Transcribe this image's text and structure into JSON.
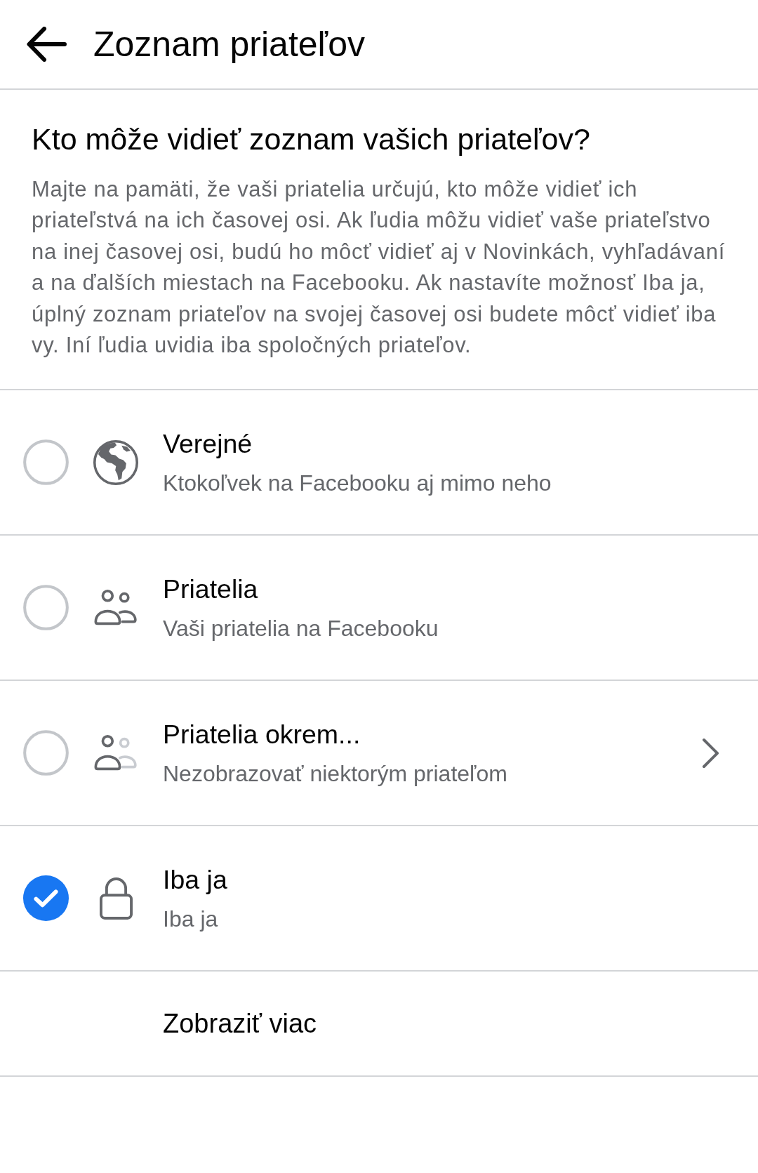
{
  "header": {
    "title": "Zoznam priateľov"
  },
  "section": {
    "heading": "Kto môže vidieť zoznam vašich priateľov?",
    "description": "Majte na pamäti, že vaši priatelia určujú, kto môže vidieť ich priateľstvá na ich časovej osi. Ak ľudia môžu vidieť vaše priateľstvo na inej časovej osi, budú ho môcť vidieť aj v Novinkách, vyhľadávaní a na ďalších miestach na Facebooku. Ak nastavíte možnosť Iba ja, úplný zoznam priateľov na svojej časovej osi budete môcť vidieť iba vy. Iní ľudia uvidia iba spoločných priateľov."
  },
  "options": [
    {
      "kind": "globe",
      "title": "Verejné",
      "subtitle": "Ktokoľvek na Facebooku aj mimo neho",
      "selected": false,
      "chevron": false
    },
    {
      "kind": "friends",
      "title": "Priatelia",
      "subtitle": "Vaši priatelia na Facebooku",
      "selected": false,
      "chevron": false
    },
    {
      "kind": "friends_except",
      "title": "Priatelia okrem...",
      "subtitle": "Nezobrazovať niektorým priateľom",
      "selected": false,
      "chevron": true
    },
    {
      "kind": "lock",
      "title": "Iba ja",
      "subtitle": "Iba ja",
      "selected": true,
      "chevron": false
    }
  ],
  "more": {
    "label": "Zobraziť viac"
  }
}
